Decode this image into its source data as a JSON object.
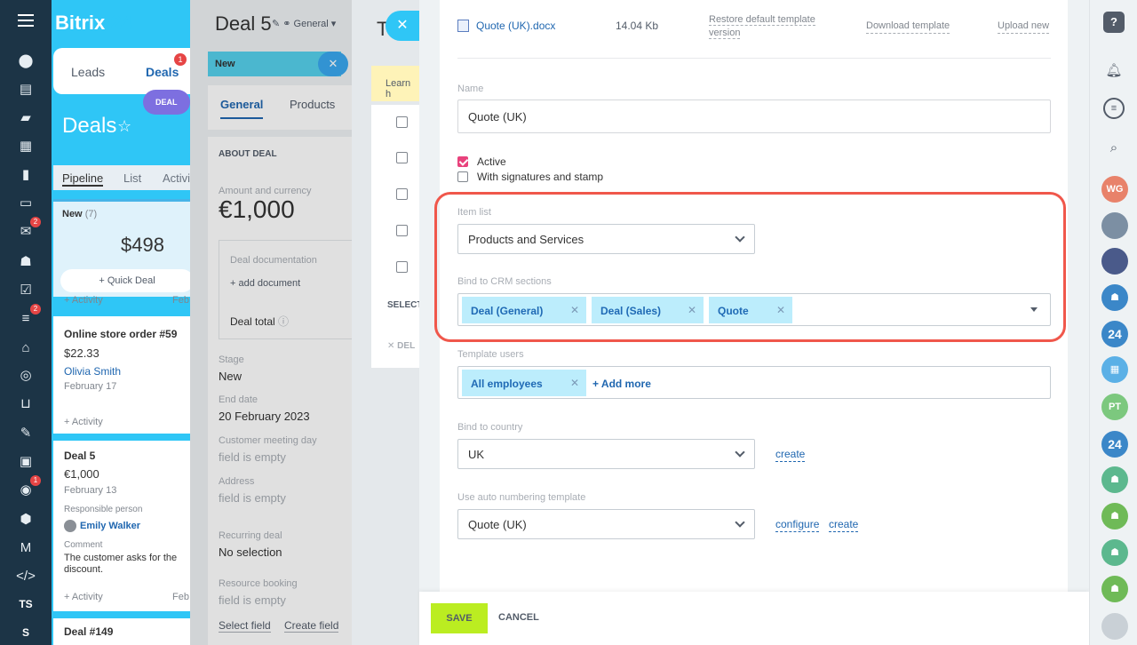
{
  "app": {
    "logo_main": "Bitrix",
    "logo_num": "24"
  },
  "leftnav": {
    "badges": [
      "2",
      "2",
      "1"
    ],
    "user_initials": "TS",
    "last": "S"
  },
  "crm_tabs": {
    "leads": "Leads",
    "deals": "Deals",
    "deals_badge": "1",
    "pill": "DEAL"
  },
  "deals_page": {
    "title": "Deals",
    "view_tabs": [
      "Pipeline",
      "List",
      "Activi"
    ],
    "column": {
      "name": "New",
      "count": "(7)",
      "amount": "$498",
      "quick_deal": "+ Quick Deal"
    },
    "activity_label": "+ Activity",
    "month_cut": "Feb",
    "cards": [
      {
        "title": "Online store order #59",
        "amount": "$22.33",
        "person": "Olivia Smith",
        "date": "February 17"
      },
      {
        "title": "Deal 5",
        "amount": "€1,000",
        "date": "February 13",
        "resp_label": "Responsible person",
        "resp_name": "Emily Walker",
        "comment_label": "Comment",
        "comment": "The customer asks for the",
        "comment2": "discount."
      },
      {
        "title": "Deal #149"
      }
    ]
  },
  "deal_slider": {
    "title": "Deal 5",
    "general": "General",
    "stage_label": "New",
    "tabs": [
      "General",
      "Products"
    ],
    "section": "ABOUT DEAL",
    "amount_label": "Amount and currency",
    "amount": "€1,000",
    "doc_label": "Deal documentation",
    "add_doc": "+ add document",
    "deal_total": "Deal total",
    "fields": [
      {
        "label": "Stage",
        "value": "New"
      },
      {
        "label": "End date",
        "value": "20 February 2023"
      },
      {
        "label": "Customer meeting day",
        "value": "field is empty"
      },
      {
        "label": "Address",
        "value": "field is empty"
      },
      {
        "label": "Recurring deal",
        "value": "No selection"
      },
      {
        "label": "Resource booking",
        "value": "field is empty"
      }
    ],
    "select_field": "Select field",
    "create_field": "Create field"
  },
  "mid_slider": {
    "learn": "Learn h",
    "select": "SELECT",
    "delete": "DEL",
    "letter": "T"
  },
  "template": {
    "file_name": "Quote (UK).docx",
    "file_size": "14.04 Kb",
    "restore_1": "Restore default template",
    "restore_2": "version",
    "download": "Download template",
    "upload": "Upload new",
    "name_label": "Name",
    "name_value": "Quote (UK)",
    "active_label": "Active",
    "signatures_label": "With signatures and stamp",
    "item_list_label": "Item list",
    "item_list_value": "Products and Services",
    "bind_crm_label": "Bind to CRM sections",
    "crm_tags": [
      "Deal (General)",
      "Deal (Sales)",
      "Quote"
    ],
    "users_label": "Template users",
    "user_tags": [
      "All employees"
    ],
    "add_more": "+ Add more",
    "country_label": "Bind to country",
    "country_value": "UK",
    "create": "create",
    "numbering_label": "Use auto numbering template",
    "numbering_value": "Quote (UK)",
    "configure": "configure"
  },
  "footer": {
    "save": "SAVE",
    "cancel": "CANCEL"
  },
  "rightbar": {
    "help": "?",
    "avatars": [
      "WG",
      "PT"
    ],
    "badge24": "24"
  },
  "colors": {
    "accent": "#2067b0",
    "save": "#bbed21",
    "highlight": "#f0574b",
    "checkbox_on": "#e8427c"
  }
}
